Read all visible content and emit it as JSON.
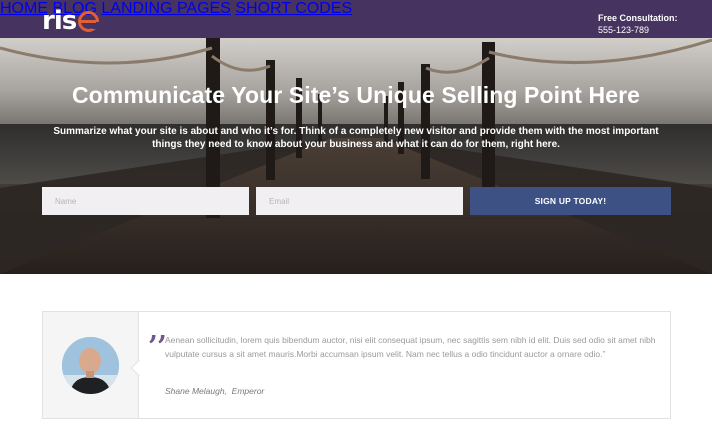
{
  "header": {
    "logo_text": "ris",
    "nav": [
      "HOME",
      "BLOG",
      "LANDING PAGES",
      "SHORT CODES"
    ],
    "consultation_label": "Free Consultation:",
    "consultation_phone": "555-123-789"
  },
  "hero": {
    "title": "Communicate Your Site’s Unique Selling Point Here",
    "subtitle": "Summarize what your site is about and who it’s for. Think of a completely new visitor and provide them with the most important things they need to know about your business and what it can do for them, right here.",
    "name_placeholder": "Name",
    "email_placeholder": "Email",
    "signup_label": "SIGN UP TODAY!"
  },
  "testimonial": {
    "quote": "Aenean sollicitudin, lorem quis bibendum auctor, nisi elit consequat ipsum, nec sagittis sem nibh id elit. Duis sed odio sit amet nibh vulputate cursus a sit amet mauris.Morbi accumsan ipsum velit. Nam nec tellus a odio tincidunt auctor a ornare odio.”",
    "author": "Shane Melaugh,",
    "role": "Emperor"
  },
  "colors": {
    "header_bg": "#46335f",
    "logo_accent": "#e45e33",
    "button_bg": "#3e5185",
    "input_bg": "#f1eff1"
  }
}
